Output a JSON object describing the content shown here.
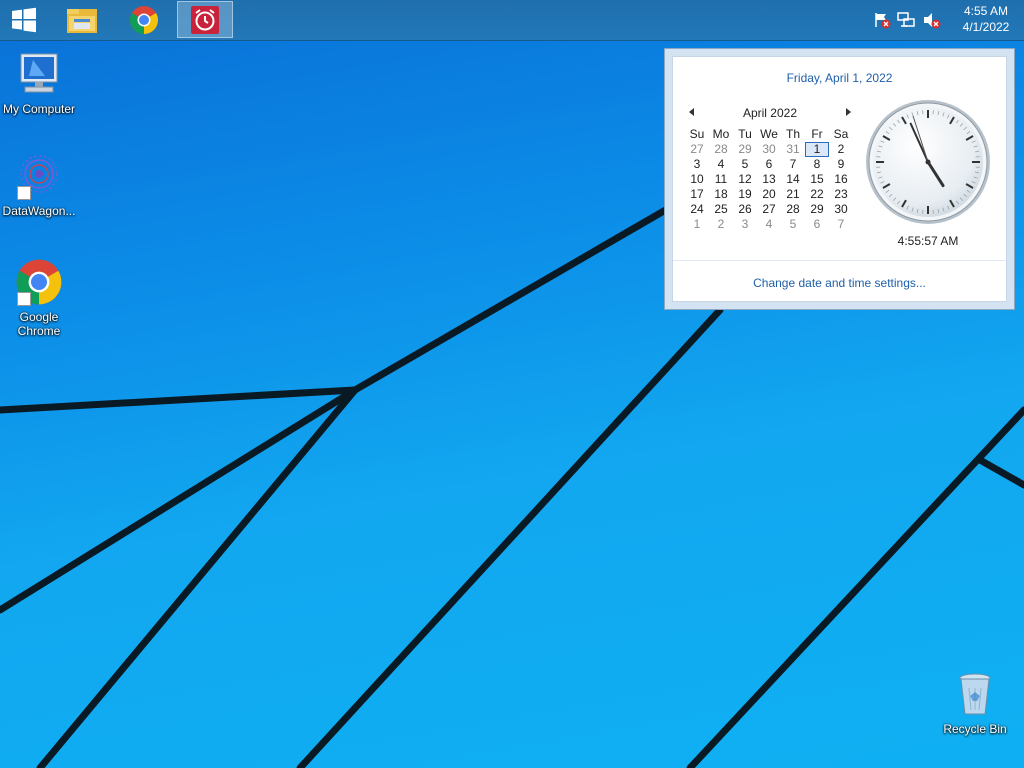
{
  "taskbar": {
    "start_icon": "windows-logo-icon",
    "pinned": [
      {
        "name": "File Explorer",
        "icon": "folder-icon"
      },
      {
        "name": "Google Chrome",
        "icon": "chrome-icon"
      },
      {
        "name": "Alarm",
        "icon": "alarm-clock-icon",
        "active": true
      }
    ],
    "tray_icons": [
      "action-center-flag-icon",
      "network-icon",
      "volume-muted-icon"
    ],
    "clock": {
      "time": "4:55 AM",
      "date": "4/1/2022"
    }
  },
  "desktop": {
    "icons": [
      {
        "label": "My Computer",
        "icon": "computer-icon"
      },
      {
        "label": "DataWagon...",
        "icon": "datawagon-icon",
        "shortcut": true
      },
      {
        "label": "Google\nChrome",
        "icon": "chrome-icon",
        "shortcut": true
      },
      {
        "label": "Recycle Bin",
        "icon": "recycle-bin-icon"
      }
    ]
  },
  "flyout": {
    "full_date": "Friday, April 1, 2022",
    "month_label": "April 2022",
    "weekdays": [
      "Su",
      "Mo",
      "Tu",
      "We",
      "Th",
      "Fr",
      "Sa"
    ],
    "days": [
      [
        "27",
        "28",
        "29",
        "30",
        "31",
        "1",
        "2"
      ],
      [
        "3",
        "4",
        "5",
        "6",
        "7",
        "8",
        "9"
      ],
      [
        "10",
        "11",
        "12",
        "13",
        "14",
        "15",
        "16"
      ],
      [
        "17",
        "18",
        "19",
        "20",
        "21",
        "22",
        "23"
      ],
      [
        "24",
        "25",
        "26",
        "27",
        "28",
        "29",
        "30"
      ],
      [
        "1",
        "2",
        "3",
        "4",
        "5",
        "6",
        "7"
      ]
    ],
    "other_month_cells": [
      [
        0,
        0
      ],
      [
        0,
        1
      ],
      [
        0,
        2
      ],
      [
        0,
        3
      ],
      [
        0,
        4
      ],
      [
        5,
        0
      ],
      [
        5,
        1
      ],
      [
        5,
        2
      ],
      [
        5,
        3
      ],
      [
        5,
        4
      ],
      [
        5,
        5
      ],
      [
        5,
        6
      ]
    ],
    "today_cell": [
      0,
      5
    ],
    "digital_time": "4:55:57 AM",
    "analog_time": {
      "hour": 4,
      "minute": 55,
      "second": 57
    },
    "settings_link": "Change date and time settings..."
  },
  "colors": {
    "accent": "#1f5fa8",
    "taskbar": "#2278b8",
    "desktop": "#0fa0ee"
  }
}
